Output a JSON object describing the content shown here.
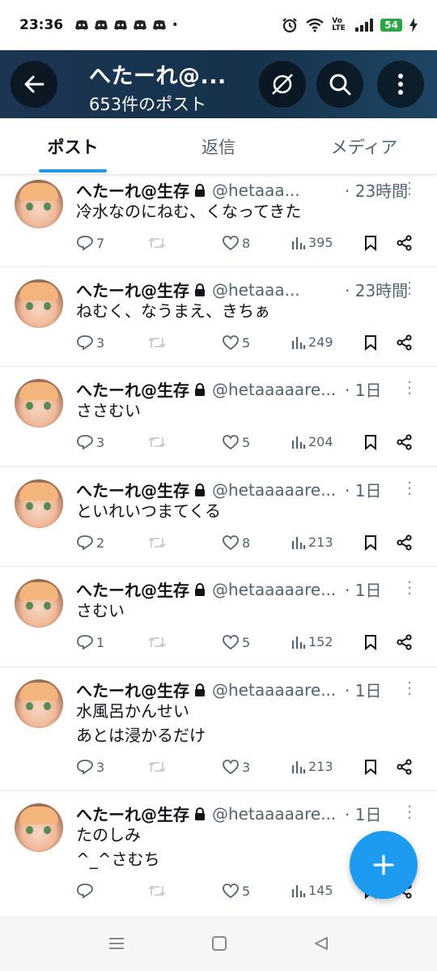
{
  "status_bar": {
    "time": "23:36",
    "dot": "•",
    "battery": "54",
    "volte": "Vo LTE"
  },
  "header": {
    "title": "へたーれ@...",
    "post_count": "653件のポスト"
  },
  "tabs": [
    {
      "label": "ポスト",
      "active": true
    },
    {
      "label": "返信",
      "active": false
    },
    {
      "label": "メディア",
      "active": false
    }
  ],
  "posts": [
    {
      "name": "へたーれ@生存",
      "handle": "@hetaaa...",
      "time": "· 23時間",
      "text": "冷水なのにねむ、くなってきた",
      "replies": "7",
      "likes": "8",
      "views": "395"
    },
    {
      "name": "へたーれ@生存",
      "handle": "@hetaaa...",
      "time": "· 23時間",
      "text": "ねむく、なうまえ、きちぁ",
      "replies": "3",
      "likes": "5",
      "views": "249"
    },
    {
      "name": "へたーれ@生存",
      "handle": "@hetaaaaare...",
      "time": "· 1日",
      "text": "ささむい",
      "replies": "3",
      "likes": "5",
      "views": "204"
    },
    {
      "name": "へたーれ@生存",
      "handle": "@hetaaaaare...",
      "time": "· 1日",
      "text": "といれいつまてくる",
      "replies": "2",
      "likes": "8",
      "views": "213"
    },
    {
      "name": "へたーれ@生存",
      "handle": "@hetaaaaare...",
      "time": "· 1日",
      "text": "さむい",
      "replies": "1",
      "likes": "5",
      "views": "152"
    },
    {
      "name": "へたーれ@生存",
      "handle": "@hetaaaaare...",
      "time": "· 1日",
      "text": "水風呂かんせい\nあとは浸かるだけ",
      "replies": "3",
      "likes": "3",
      "views": "213"
    },
    {
      "name": "へたーれ@生存",
      "handle": "@hetaaaaare...",
      "time": "· 1日",
      "text": "たのしみ\n^_^さむち",
      "replies": "",
      "likes": "5",
      "views": "145"
    }
  ],
  "colors": {
    "accent": "#1d9bf0",
    "header_bg": "#17324d",
    "muted_text": "#536471"
  }
}
